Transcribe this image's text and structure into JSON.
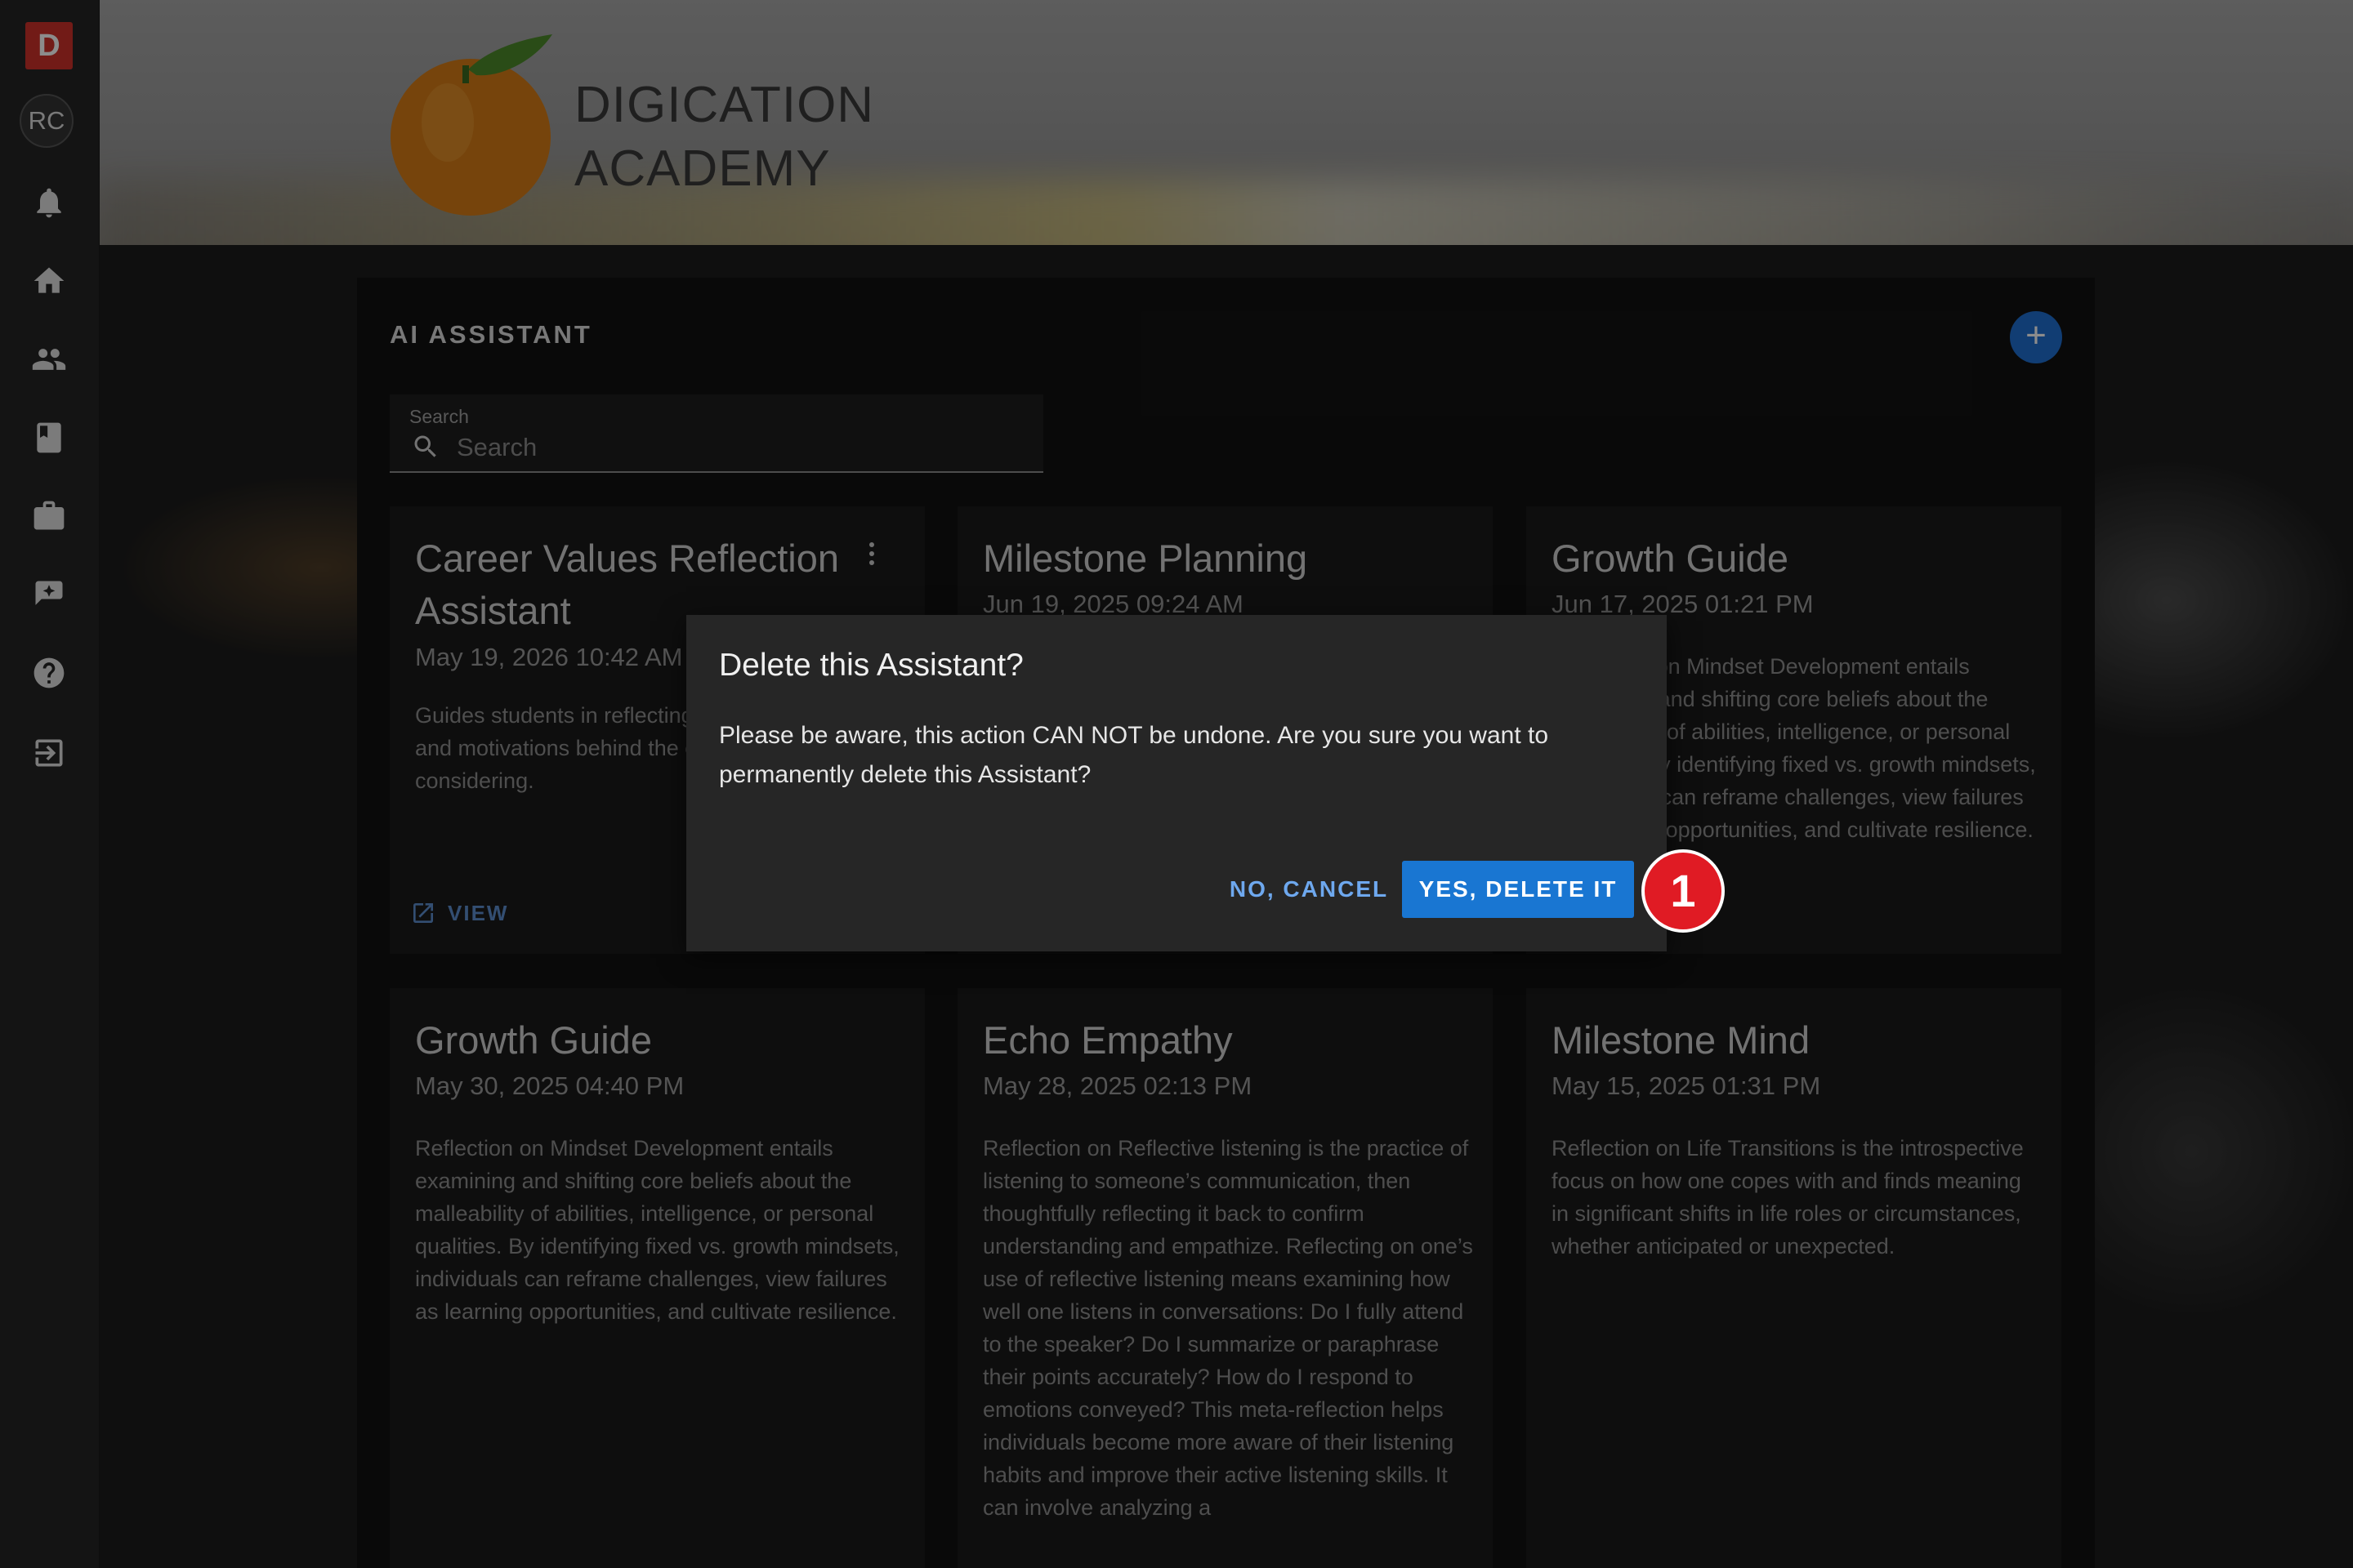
{
  "sidebar": {
    "brand_letter": "D",
    "avatar_initials": "RC",
    "items": [
      {
        "icon": "bell-icon",
        "label": "Notifications"
      },
      {
        "icon": "home-icon",
        "label": "Home"
      },
      {
        "icon": "people-icon",
        "label": "Community"
      },
      {
        "icon": "book-icon",
        "label": "Courses"
      },
      {
        "icon": "briefcase-icon",
        "label": "Portfolio"
      },
      {
        "icon": "ai-sparkle-icon",
        "label": "AI Assistant"
      },
      {
        "icon": "help-icon",
        "label": "Help"
      },
      {
        "icon": "logout-icon",
        "label": "Log out"
      }
    ]
  },
  "header": {
    "logo_line1": "DIGICATION",
    "logo_line2": "ACADEMY"
  },
  "panel": {
    "title": "AI ASSISTANT",
    "add_button": "+",
    "search": {
      "label": "Search",
      "placeholder": "Search"
    }
  },
  "cards": [
    {
      "title": "Career Values Reflection Assistant",
      "date": "May 19, 2026 10:42 AM",
      "description": "Guides students in reflecting on personal values and motivations behind the career paths they are considering.",
      "view_label": "VIEW"
    },
    {
      "title": "Milestone Planning",
      "date": "Jun 19, 2025 09:24 AM",
      "description": ""
    },
    {
      "title": "Growth Guide",
      "date": "Jun 17, 2025 01:21 PM",
      "description": "Reflection on Mindset Development entails examining and shifting core beliefs about the malleability of abilities, intelligence, or personal qualities. By identifying fixed vs. growth mindsets, individuals can reframe challenges, view failures as learning opportunities, and cultivate resilience."
    },
    {
      "title": "Growth Guide",
      "date": "May 30, 2025 04:40 PM",
      "description": "Reflection on Mindset Development entails examining and shifting core beliefs about the malleability of abilities, intelligence, or personal qualities. By identifying fixed vs. growth mindsets, individuals can reframe challenges, view failures as learning opportunities, and cultivate resilience."
    },
    {
      "title": "Echo Empathy",
      "date": "May 28, 2025 02:13 PM",
      "description": "Reflection on Reflective listening is the practice of listening to someone’s communication, then thoughtfully reflecting it back to confirm understanding and empathize. Reflecting on one’s use of reflective listening means examining how well one listens in conversations: Do I fully attend to the speaker? Do I summarize or paraphrase their points accurately? How do I respond to emotions conveyed? This meta-reflection helps individuals become more aware of their listening habits and improve their active listening skills. It can involve analyzing a"
    },
    {
      "title": "Milestone Mind",
      "date": "May 15, 2025 01:31 PM",
      "description": "Reflection on Life Transitions is the introspective focus on how one copes with and finds meaning in significant shifts in life roles or circumstances, whether anticipated or unexpected."
    }
  ],
  "dialog": {
    "title": "Delete this Assistant?",
    "body": "Please be aware, this action CAN NOT be undone. Are you sure you want to permanently delete this Assistant?",
    "cancel_label": "NO, CANCEL",
    "confirm_label": "YES, DELETE IT"
  },
  "annotation": {
    "step": "1"
  },
  "colors": {
    "accent": "#1976d2",
    "brand_red": "#d0322a",
    "marker_red": "#e01b24",
    "overlay": "rgba(0,0,0,0.45)"
  }
}
